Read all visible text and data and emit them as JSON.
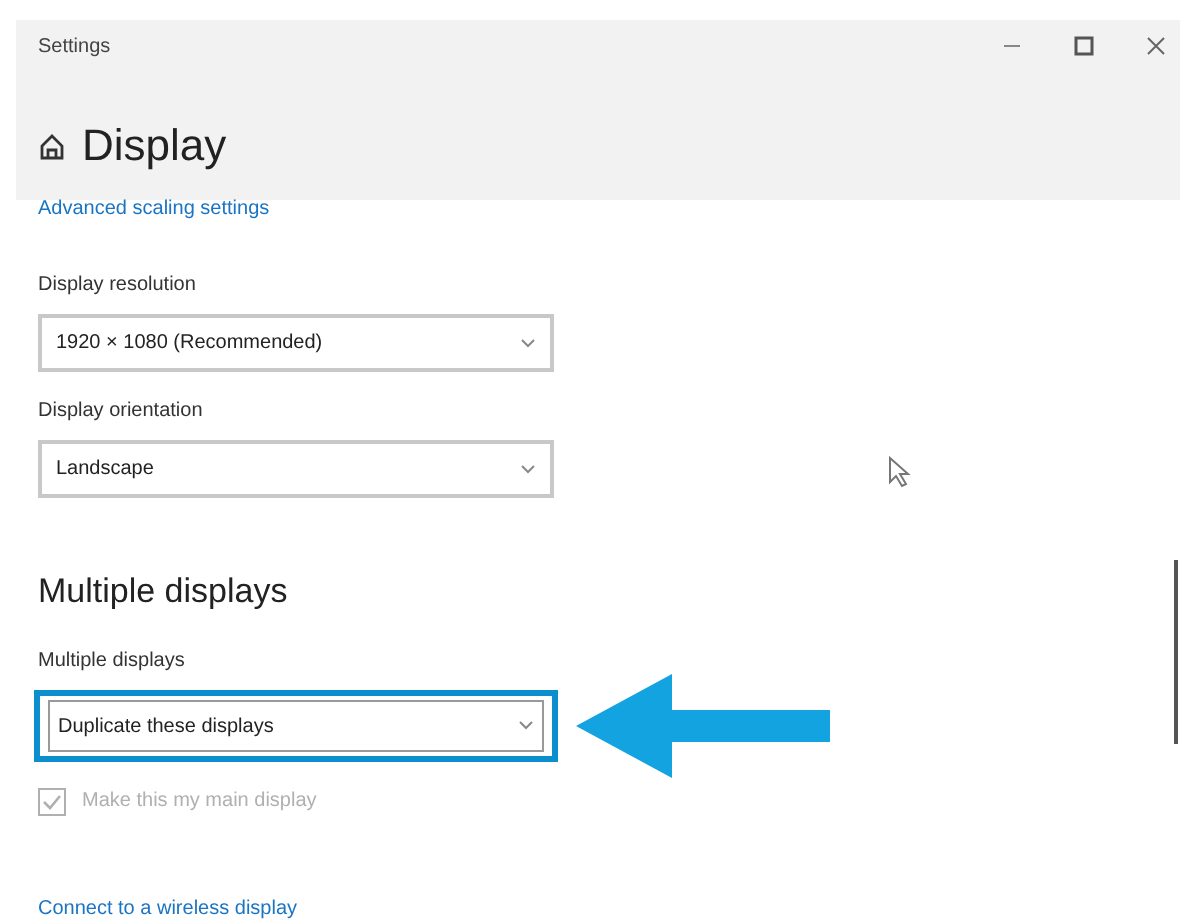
{
  "window": {
    "title": "Settings"
  },
  "page": {
    "title": "Display"
  },
  "top_link": "Advanced scaling settings",
  "dropdowns_top": [
    {
      "label": "Display resolution",
      "value": "1920 × 1080 (Recommended)",
      "highlighted": false
    },
    {
      "label": "Display orientation",
      "value": "Landscape",
      "highlighted": false
    }
  ],
  "section": {
    "heading": "Multiple displays"
  },
  "dropdowns_section": [
    {
      "label": "Multiple displays",
      "value": "Duplicate these displays",
      "highlighted": true
    }
  ],
  "checkbox": {
    "label": "Make this my main display",
    "checked": true,
    "disabled": true
  },
  "bottom_link": "Connect to a wireless display"
}
